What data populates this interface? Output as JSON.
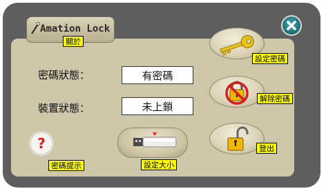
{
  "app": {
    "title": "Amation Lock"
  },
  "status": {
    "password_label": "密碼狀態：",
    "password_value": "有密碼",
    "device_label": "裝置狀態：",
    "device_value": "未上鎖"
  },
  "tooltips": {
    "about": "關於",
    "set_password": "設定密碼",
    "remove_password": "解除密碼",
    "logout": "登出",
    "password_hint": "密碼提示",
    "set_size": "設定大小"
  },
  "icons": {
    "title": "wand-icon",
    "close": "close-icon",
    "set_password": "key-icon",
    "remove_password": "no-lock-icon",
    "logout": "unlocked-padlock-icon",
    "hint": "question-mark-icon",
    "size": "usb-drive-icon"
  },
  "colors": {
    "panel": "#5e5e5e",
    "body": "#cec6a8",
    "tooltip": "#ffff00",
    "close_button": "#1e6d74",
    "key": "#e8c21a",
    "forbid": "#d22020"
  }
}
